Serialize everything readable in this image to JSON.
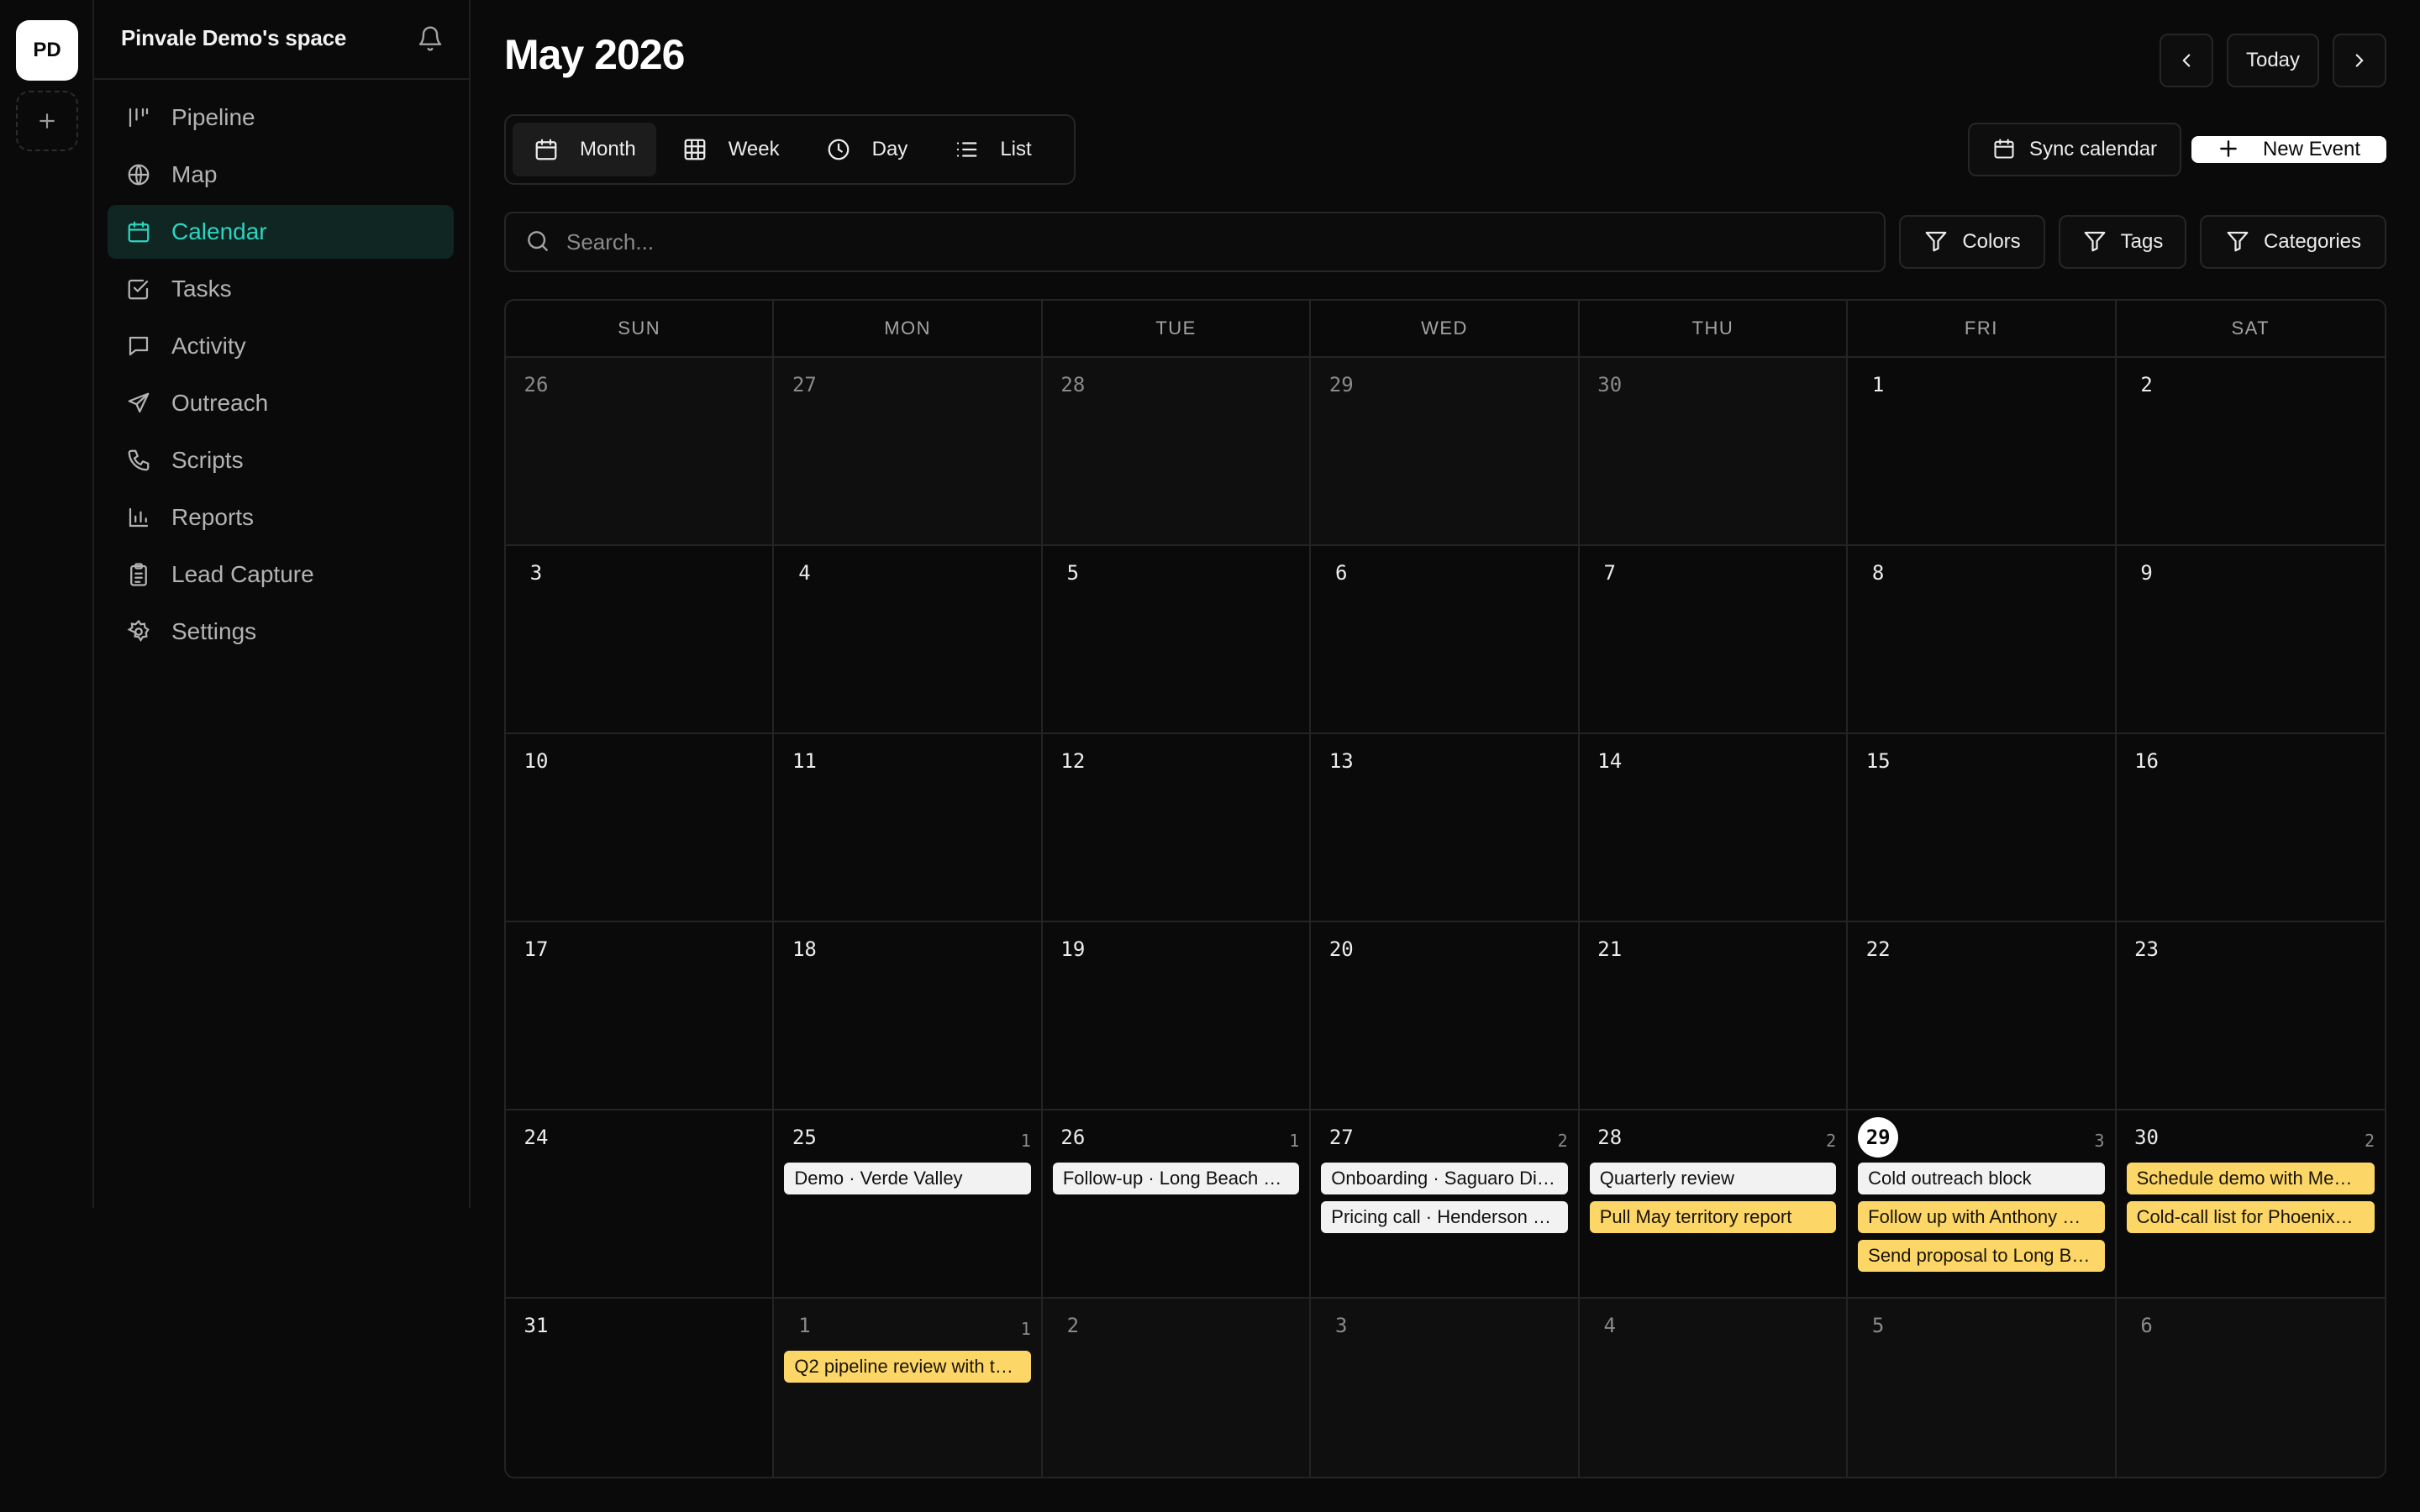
{
  "workspace": {
    "initials": "PD"
  },
  "sidebar": {
    "space_name": "Pinvale Demo's space",
    "items": [
      {
        "label": "Pipeline",
        "icon": "pipeline-icon"
      },
      {
        "label": "Map",
        "icon": "globe-icon"
      },
      {
        "label": "Calendar",
        "icon": "calendar-icon",
        "active": true
      },
      {
        "label": "Tasks",
        "icon": "check-square-icon"
      },
      {
        "label": "Activity",
        "icon": "message-icon"
      },
      {
        "label": "Outreach",
        "icon": "send-icon"
      },
      {
        "label": "Scripts",
        "icon": "phone-icon"
      },
      {
        "label": "Reports",
        "icon": "bar-chart-icon"
      },
      {
        "label": "Lead Capture",
        "icon": "clipboard-icon"
      },
      {
        "label": "Settings",
        "icon": "gear-icon"
      }
    ]
  },
  "header": {
    "title": "May 2026",
    "today_label": "Today"
  },
  "views": {
    "month": "Month",
    "week": "Week",
    "day": "Day",
    "list": "List",
    "active": "Month"
  },
  "actions": {
    "sync_label": "Sync calendar",
    "new_event_label": "New Event"
  },
  "search": {
    "placeholder": "Search..."
  },
  "filters": {
    "colors": "Colors",
    "tags": "Tags",
    "categories": "Categories"
  },
  "calendar": {
    "weekdays": [
      "SUN",
      "MON",
      "TUE",
      "WED",
      "THU",
      "FRI",
      "SAT"
    ],
    "days": [
      {
        "n": "26",
        "outside": true
      },
      {
        "n": "27",
        "outside": true
      },
      {
        "n": "28",
        "outside": true
      },
      {
        "n": "29",
        "outside": true
      },
      {
        "n": "30",
        "outside": true
      },
      {
        "n": "1"
      },
      {
        "n": "2"
      },
      {
        "n": "3"
      },
      {
        "n": "4"
      },
      {
        "n": "5"
      },
      {
        "n": "6"
      },
      {
        "n": "7"
      },
      {
        "n": "8"
      },
      {
        "n": "9"
      },
      {
        "n": "10"
      },
      {
        "n": "11"
      },
      {
        "n": "12"
      },
      {
        "n": "13"
      },
      {
        "n": "14"
      },
      {
        "n": "15"
      },
      {
        "n": "16"
      },
      {
        "n": "17"
      },
      {
        "n": "18"
      },
      {
        "n": "19"
      },
      {
        "n": "20"
      },
      {
        "n": "21"
      },
      {
        "n": "22"
      },
      {
        "n": "23"
      },
      {
        "n": "24"
      },
      {
        "n": "25",
        "count": "1",
        "events": [
          {
            "t": "Demo · Verde Valley",
            "c": "white"
          }
        ]
      },
      {
        "n": "26",
        "count": "1",
        "events": [
          {
            "t": "Follow-up · Long Beach …",
            "c": "white"
          }
        ]
      },
      {
        "n": "27",
        "count": "2",
        "events": [
          {
            "t": "Onboarding · Saguaro Di…",
            "c": "white"
          },
          {
            "t": "Pricing call · Henderson …",
            "c": "white"
          }
        ]
      },
      {
        "n": "28",
        "count": "2",
        "events": [
          {
            "t": "Quarterly review",
            "c": "white"
          },
          {
            "t": "Pull May territory report",
            "c": "yellow"
          }
        ]
      },
      {
        "n": "29",
        "today": true,
        "count": "3",
        "events": [
          {
            "t": "Cold outreach block",
            "c": "white"
          },
          {
            "t": "Follow up with Anthony …",
            "c": "yellow"
          },
          {
            "t": "Send proposal to Long B…",
            "c": "yellow"
          }
        ]
      },
      {
        "n": "30",
        "count": "2",
        "events": [
          {
            "t": "Schedule demo with Me…",
            "c": "yellow"
          },
          {
            "t": "Cold-call list for Phoenix…",
            "c": "yellow"
          }
        ]
      },
      {
        "n": "31"
      },
      {
        "n": "1",
        "outside": true,
        "count": "1",
        "events": [
          {
            "t": "Q2 pipeline review with t…",
            "c": "yellow"
          }
        ]
      },
      {
        "n": "2",
        "outside": true
      },
      {
        "n": "3",
        "outside": true
      },
      {
        "n": "4",
        "outside": true
      },
      {
        "n": "5",
        "outside": true
      },
      {
        "n": "6",
        "outside": true
      }
    ]
  },
  "colors": {
    "accent": "#2dd4bf",
    "event_default": "#f2f2f2",
    "event_highlight": "#fcd667"
  }
}
